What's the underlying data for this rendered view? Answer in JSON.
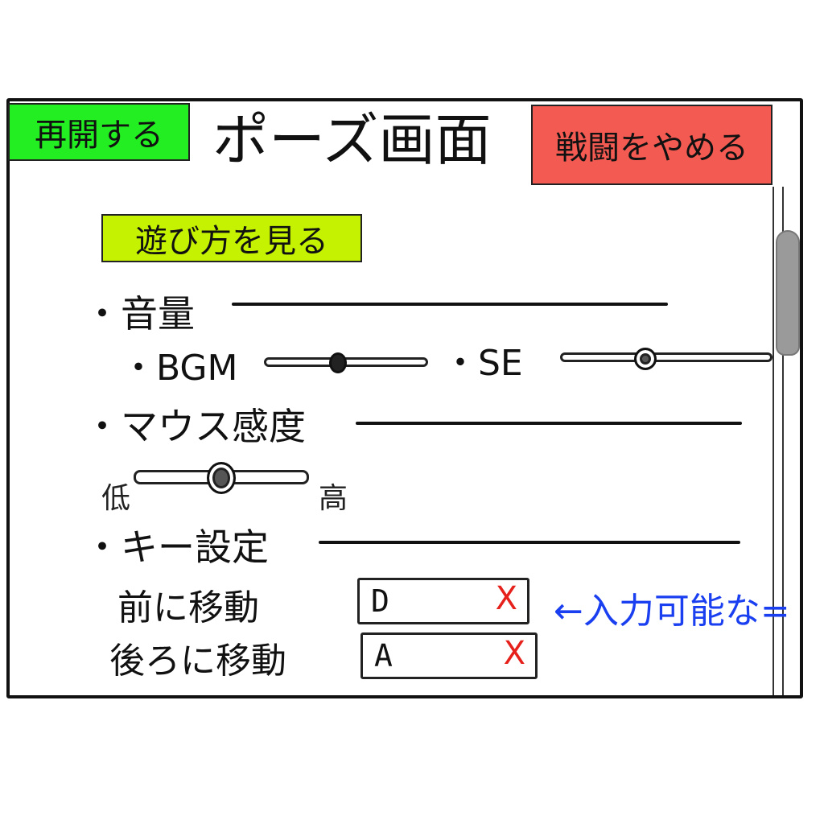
{
  "header": {
    "resume_label": "再開する",
    "title": "ポーズ画面",
    "quit_label": "戦闘をやめる"
  },
  "howto_label": "遊び方を見る",
  "volume": {
    "heading": "・音量",
    "bgm_label": "・BGM",
    "se_label": "・SE",
    "bgm_level": 0.45,
    "se_level": 0.4
  },
  "mouse": {
    "heading": "・マウス感度",
    "low_label": "低",
    "high_label": "高",
    "level": 0.5
  },
  "keys": {
    "heading": "・キー設定",
    "rows": [
      {
        "label": "前に移動",
        "value": "D",
        "clear": "X"
      },
      {
        "label": "後ろに移動",
        "value": "A",
        "clear": "X"
      }
    ],
    "annotation": "←入力可能な="
  },
  "colors": {
    "resume": "#22ee22",
    "quit": "#f35a52",
    "howto": "#c5f200",
    "annotation": "#1a3ff0",
    "clear_x": "#e6201a"
  }
}
